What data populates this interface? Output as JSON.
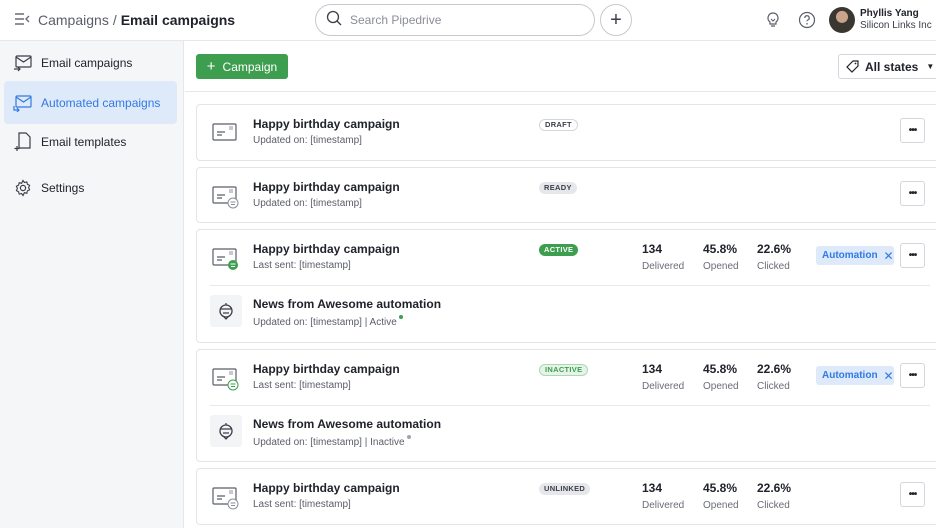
{
  "topbar": {
    "menu_icon": "menu-collapse-icon",
    "breadcrumb_root": "Campaigns",
    "breadcrumb_sep": "/",
    "breadcrumb_current": "Email campaigns",
    "search_placeholder": "Search Pipedrive",
    "add_label": "+",
    "user_name": "Phyllis Yang",
    "user_company": "Silicon Links Inc"
  },
  "sidebar": {
    "items": [
      {
        "label": "Email campaigns",
        "icon": "email-send-icon",
        "active": false
      },
      {
        "label": "Automated campaigns",
        "icon": "email-automation-icon",
        "active": true
      },
      {
        "label": "Email templates",
        "icon": "template-icon",
        "active": false
      },
      {
        "label": "Settings",
        "icon": "gear-icon",
        "active": false
      }
    ]
  },
  "toolbar": {
    "campaign_button": "Campaign",
    "campaign_plus": "+",
    "states_filter": "All states"
  },
  "colors": {
    "primary_green": "#3e9e4f",
    "accent_blue": "#317ae2",
    "active_nav_bg": "#dee9fa"
  },
  "campaigns": [
    {
      "title": "Happy birthday campaign",
      "subtitle": "Updated on: [timestamp]",
      "status": "DRAFT"
    },
    {
      "title": "Happy birthday campaign",
      "subtitle": "Updated on: [timestamp]",
      "status": "READY"
    },
    {
      "title": "Happy birthday campaign",
      "subtitle": "Last sent: [timestamp]",
      "status": "ACTIVE",
      "stats": [
        {
          "value": "134",
          "label": "Delivered"
        },
        {
          "value": "45.8%",
          "label": "Opened"
        },
        {
          "value": "22.6%",
          "label": "Clicked"
        }
      ],
      "tag": "Automation",
      "automation": {
        "title": "News from Awesome automation",
        "subtitle": "Updated on: [timestamp] | Active",
        "dot_color": "#3e9e4f"
      }
    },
    {
      "title": "Happy birthday campaign",
      "subtitle": "Last sent: [timestamp]",
      "status": "INACTIVE",
      "stats": [
        {
          "value": "134",
          "label": "Delivered"
        },
        {
          "value": "45.8%",
          "label": "Opened"
        },
        {
          "value": "22.6%",
          "label": "Clicked"
        }
      ],
      "tag": "Automation",
      "automation": {
        "title": "News from Awesome automation",
        "subtitle": "Updated on: [timestamp] | Inactive",
        "dot_color": "#a0a3ab"
      }
    },
    {
      "title": "Happy birthday campaign",
      "subtitle": "Last sent: [timestamp]",
      "status": "UNLINKED",
      "stats": [
        {
          "value": "134",
          "label": "Delivered"
        },
        {
          "value": "45.8%",
          "label": "Opened"
        },
        {
          "value": "22.6%",
          "label": "Clicked"
        }
      ]
    }
  ],
  "more_label": "•••",
  "tag_close": "✕"
}
